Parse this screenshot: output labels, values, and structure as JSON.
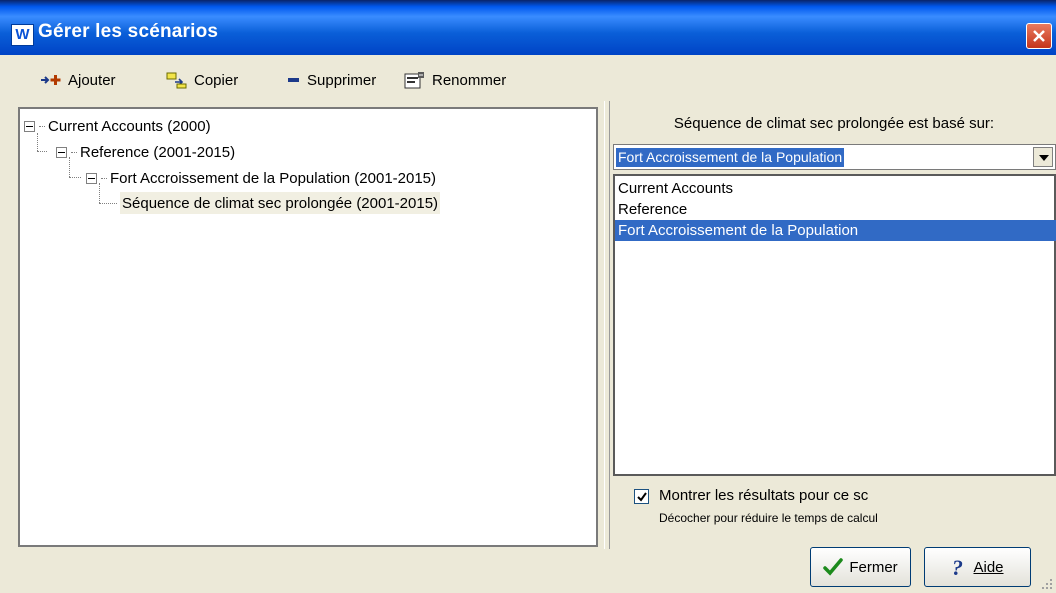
{
  "window": {
    "title": "Gérer les scénarios",
    "app_icon_letter": "W",
    "accent_color": "#0058ee",
    "selection_color": "#316ac5"
  },
  "toolbar": {
    "add_label": "Ajouter",
    "copy_label": "Copier",
    "delete_label": "Supprimer",
    "rename_label": "Renommer"
  },
  "tree": {
    "items": [
      {
        "label": "Current Accounts (2000)",
        "expanded": true
      },
      {
        "label": "Reference (2001-2015)",
        "expanded": true
      },
      {
        "label": "Fort Accroissement de la Population (2001-2015)",
        "expanded": true
      },
      {
        "label": "Séquence de climat sec prolongée (2001-2015)",
        "selected": true
      }
    ]
  },
  "right": {
    "based_on_label": "Séquence de climat sec prolongée est basé sur:",
    "combo_value": "Fort Accroissement de la Population",
    "list_items": [
      "Current Accounts",
      "Reference",
      "Fort Accroissement de la Population"
    ],
    "selected_index": 2,
    "show_results_label": "Montrer les résultats pour ce sc",
    "show_results_checked": true,
    "hint": "Décocher pour réduire le temps de calcul"
  },
  "buttons": {
    "close_label": "Fermer",
    "help_label": "Aide"
  },
  "icons": {
    "add": "add-icon",
    "copy": "copy-icon",
    "delete": "delete-icon",
    "rename": "rename-icon",
    "close_window": "close-icon",
    "check": "checkmark-icon",
    "help": "question-mark-icon"
  }
}
